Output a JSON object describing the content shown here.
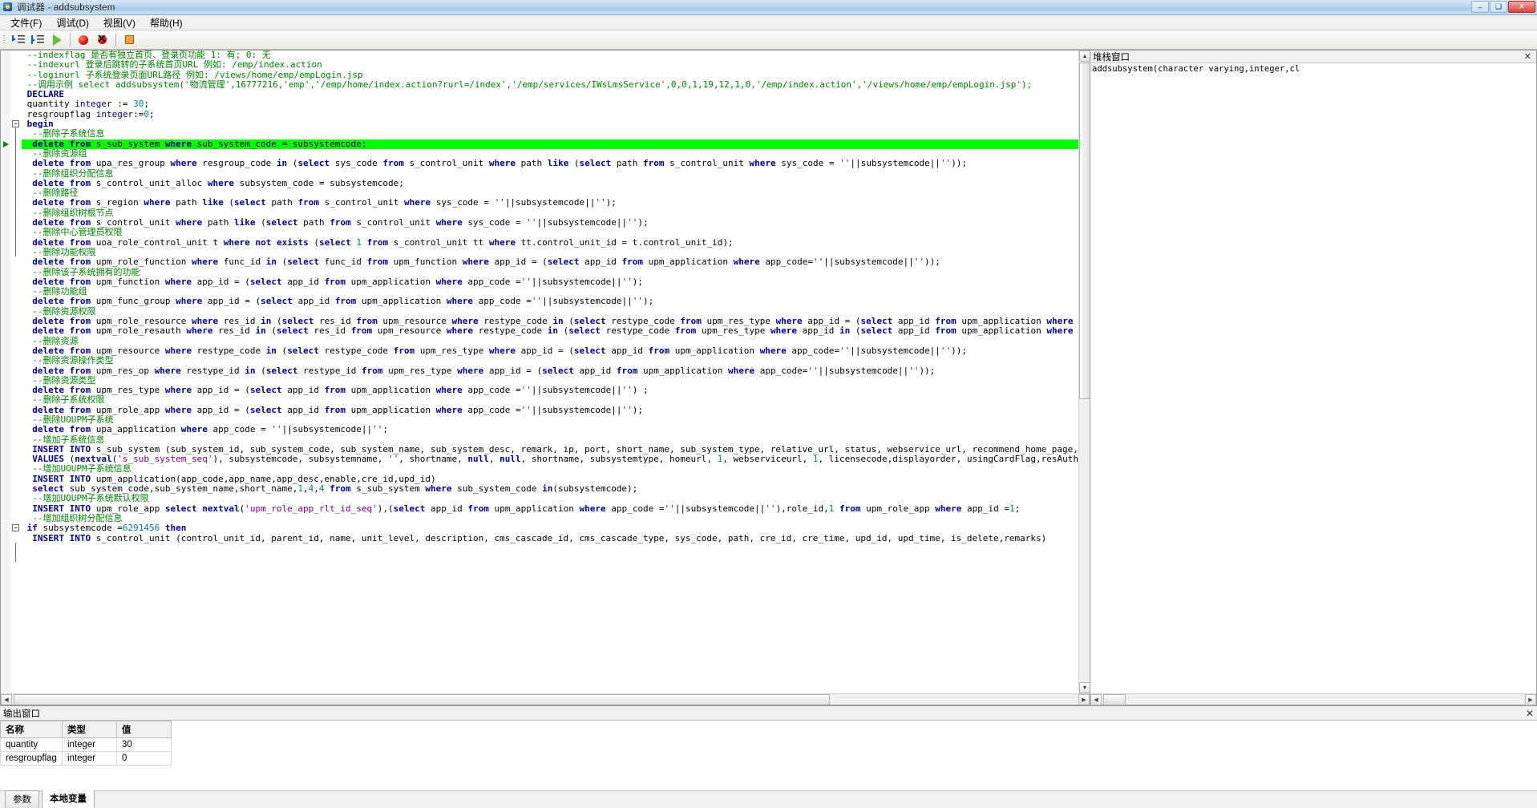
{
  "window": {
    "title": "调试器 - addsubsystem",
    "icon": "debugger-icon",
    "minimize": "–",
    "maximize": "❑",
    "close": "✕"
  },
  "menu": {
    "items": [
      {
        "label": "文件(F)",
        "name": "menu-file"
      },
      {
        "label": "调试(D)",
        "name": "menu-debug"
      },
      {
        "label": "视图(V)",
        "name": "menu-view"
      },
      {
        "label": "帮助(H)",
        "name": "menu-help"
      }
    ]
  },
  "toolbar": {
    "buttons": [
      {
        "name": "step-into-button",
        "icon": "step-into-icon",
        "title": "单步进入"
      },
      {
        "name": "step-over-button",
        "icon": "step-over-icon",
        "title": "单步跳过"
      },
      {
        "name": "run-button",
        "icon": "run-icon",
        "title": "继续运行"
      },
      {
        "name": "toggle-breakpoint-button",
        "icon": "breakpoint-icon",
        "title": "设置断点"
      },
      {
        "name": "clear-breakpoints-button",
        "icon": "breakpoint-remove-icon",
        "title": "清除断点"
      },
      {
        "name": "stop-button",
        "icon": "stop-icon",
        "title": "停止调试"
      }
    ]
  },
  "editor": {
    "current_line_index": 9,
    "lines": [
      {
        "t": "--indexflag 是否有独立首页、登录页功能 1: 有; 0: 无",
        "k": "cmt",
        "ind": 1
      },
      {
        "t": "--indexurl 登录后跳转的子系统首页URL 例如: /emp/index.action",
        "k": "cmt",
        "ind": 1
      },
      {
        "t": "--loginurl 子系统登录页面URL路径 例如: /views/home/emp/empLogin.jsp",
        "k": "cmt",
        "ind": 1
      },
      {
        "t": "--调用示例 select addsubsystem('物流管理',16777216,'emp','/emp/home/index.action?rurl=/index','/emp/services/IWsLmsService',0,0,1,19,12,1,0,'/emp/index.action','/views/home/emp/empLogin.jsp');",
        "k": "cmt",
        "ind": 1
      },
      {
        "t": "DECLARE",
        "k": "kw",
        "ind": 1
      },
      {
        "t": "quantity integer := 30;",
        "k": "mixed-decl1",
        "ind": 1
      },
      {
        "t": "resgroupflag integer:=0;",
        "k": "mixed-decl2",
        "ind": 1
      },
      {
        "t": "begin",
        "k": "kw",
        "ind": 1,
        "fold": "minus"
      },
      {
        "t": "--删除子系统信息",
        "k": "cmt",
        "ind": 2
      },
      {
        "t": "delete from s_sub_system where sub_system_code = subsystemcode;",
        "k": "sql",
        "ind": 2,
        "hl": true
      },
      {
        "t": "--删除资源组",
        "k": "cmt",
        "ind": 2
      },
      {
        "t": "delete from upa_res_group where resgroup_code in (select sys_code from s_control_unit where path like (select path from s_control_unit where sys_code = ''||subsystemcode||''));",
        "k": "sql",
        "ind": 2
      },
      {
        "t": "--删除组织分配信息",
        "k": "cmt",
        "ind": 2
      },
      {
        "t": "delete from s_control_unit_alloc where subsystem_code = subsystemcode;",
        "k": "sql",
        "ind": 2
      },
      {
        "t": "--删除路径",
        "k": "cmt",
        "ind": 2
      },
      {
        "t": "delete from s_region where path like (select path from s_control_unit where sys_code = ''||subsystemcode||'');",
        "k": "sql",
        "ind": 2
      },
      {
        "t": "--删除组织树根节点",
        "k": "cmt",
        "ind": 2
      },
      {
        "t": "delete from s_control_unit where path like (select path from s_control_unit where sys_code = ''||subsystemcode||'');",
        "k": "sql",
        "ind": 2
      },
      {
        "t": "--删除中心管理员权限",
        "k": "cmt",
        "ind": 2
      },
      {
        "t": "delete from uoa_role_control_unit t where not exists (select 1 from s_control_unit tt where tt.control_unit_id = t.control_unit_id);",
        "k": "sql",
        "ind": 2,
        "fold": "end"
      },
      {
        "t": "--删除功能权限",
        "k": "cmt",
        "ind": 2
      },
      {
        "t": "delete from upm_role_function where func_id in (select func_id from upm_function where app_id = (select app_id from upm_application where app_code=''||subsystemcode||''));",
        "k": "sql",
        "ind": 2
      },
      {
        "t": "--删除该子系统拥有的功能",
        "k": "cmt",
        "ind": 2
      },
      {
        "t": "delete from upm_function where app_id = (select app_id from upm_application where app_code =''||subsystemcode||'');",
        "k": "sql",
        "ind": 2
      },
      {
        "t": "--删除功能组",
        "k": "cmt",
        "ind": 2
      },
      {
        "t": "delete from upm_func_group where app_id = (select app_id from upm_application where app_code =''||subsystemcode||'');",
        "k": "sql",
        "ind": 2
      },
      {
        "t": "--删除资源权限",
        "k": "cmt",
        "ind": 2
      },
      {
        "t": "delete from upm_role_resource where res_id in (select res_id from upm_resource where restype_code in (select restype_code from upm_res_type where app_id = (select app_id from upm_application where app_code =''||subsystemcode||''))",
        "k": "sql",
        "ind": 2
      },
      {
        "t": "delete from upm_role_resauth where res_id in (select res_id from upm_resource where restype_code in (select restype_code from upm_res_type where app_id in (select app_id from upm_application where app_code in (''||subsystemcode||''",
        "k": "sql",
        "ind": 2
      },
      {
        "t": "--删除资源",
        "k": "cmt",
        "ind": 2
      },
      {
        "t": "delete from upm_resource where restype_code in (select restype_code from upm_res_type where app_id = (select app_id from upm_application where app_code=''||subsystemcode||''));",
        "k": "sql",
        "ind": 2
      },
      {
        "t": "--删除资源操作类型",
        "k": "cmt",
        "ind": 2
      },
      {
        "t": "delete from upm_res_op where restype_id in (select restype_id from upm_res_type where app_id = (select app_id from upm_application where app_code=''||subsystemcode||''));",
        "k": "sql",
        "ind": 2
      },
      {
        "t": "--删除资源类型",
        "k": "cmt",
        "ind": 2
      },
      {
        "t": "delete from upm_res_type where app_id = (select app_id from upm_application where app_code =''||subsystemcode||'') ;",
        "k": "sql",
        "ind": 2
      },
      {
        "t": "--删除子系统权限",
        "k": "cmt",
        "ind": 2
      },
      {
        "t": "delete from upm_role_app where app_id = (select app_id from upm_application where app_code =''||subsystemcode||'');",
        "k": "sql",
        "ind": 2
      },
      {
        "t": "--删除UOUPM子系统",
        "k": "cmt",
        "ind": 2
      },
      {
        "t": "delete from upa_application where app_code = ''||subsystemcode||'';",
        "k": "sql",
        "ind": 2
      },
      {
        "t": "--增加子系统信息",
        "k": "cmt",
        "ind": 2
      },
      {
        "t": "INSERT INTO s_sub_system (sub_system_id, sub_system_code, sub_system_name, sub_system_desc, remark, ip, port, short_name, sub_system_type, relative_url, status, webservice_url, recommend_home_page, license_mapping_code, display_o",
        "k": "sql",
        "ind": 2
      },
      {
        "t": "VALUES (nextval('s_sub_system_seq'), subsystemcode, subsystemname, '', shortname, null, null, shortname, subsystemtype, homeurl, 1, webserviceurl, 1, licensecode,displayorder, usingCardFlag,resAuthFlag,indexflag,indexurl,loginurl",
        "k": "sql",
        "ind": 2
      },
      {
        "t": "--增加UOUPM子系统信息",
        "k": "cmt",
        "ind": 2
      },
      {
        "t": "INSERT INTO upm_application(app_code,app_name,app_desc,enable,cre_id,upd_id)",
        "k": "sql",
        "ind": 2
      },
      {
        "t": "select sub_system_code,sub_system_name,short_name,1,4,4 from s_sub_system where sub_system_code in(subsystemcode);",
        "k": "sql",
        "ind": 2
      },
      {
        "t": "--增加UOUPM子系统默认权限",
        "k": "cmt",
        "ind": 2
      },
      {
        "t": "INSERT INTO upm_role_app select nextval('upm_role_app_rlt_id_seq'),(select app_id from upm_application where app_code =''||subsystemcode||''),role_id,1 from upm_role_app where app_id =1;",
        "k": "sql",
        "ind": 2
      },
      {
        "t": "--增加组织树分配信息",
        "k": "cmt",
        "ind": 2
      },
      {
        "t": "if subsystemcode =6291456 then",
        "k": "sql",
        "ind": 1,
        "fold": "minus"
      },
      {
        "t": "INSERT INTO s_control_unit (control_unit_id, parent_id, name, unit_level, description, cms_cascade_id, cms_cascade_type, sys_code, path, cre_id, cre_time, upd_id, upd_time, is_delete,remarks)",
        "k": "sql",
        "ind": 2
      }
    ]
  },
  "stack_panel": {
    "title": "堆栈窗口",
    "close": "✕",
    "rows": [
      "addsubsystem(character varying,integer,cl"
    ]
  },
  "output_panel": {
    "title": "输出窗口",
    "close": "✕",
    "table": {
      "headers": [
        "名称",
        "类型",
        "值"
      ],
      "rows": [
        [
          "quantity",
          "integer",
          "30"
        ],
        [
          "resgroupflag",
          "integer",
          "0"
        ]
      ]
    },
    "tabs": [
      {
        "label": "参数",
        "active": false,
        "name": "tab-parameters"
      },
      {
        "label": "本地变量",
        "active": true,
        "name": "tab-local-variables"
      }
    ]
  },
  "colors": {
    "highlight_line": "#00ff00",
    "comment": "#008000",
    "keyword": "#00008b",
    "string": "#800080",
    "number": "#008080"
  }
}
